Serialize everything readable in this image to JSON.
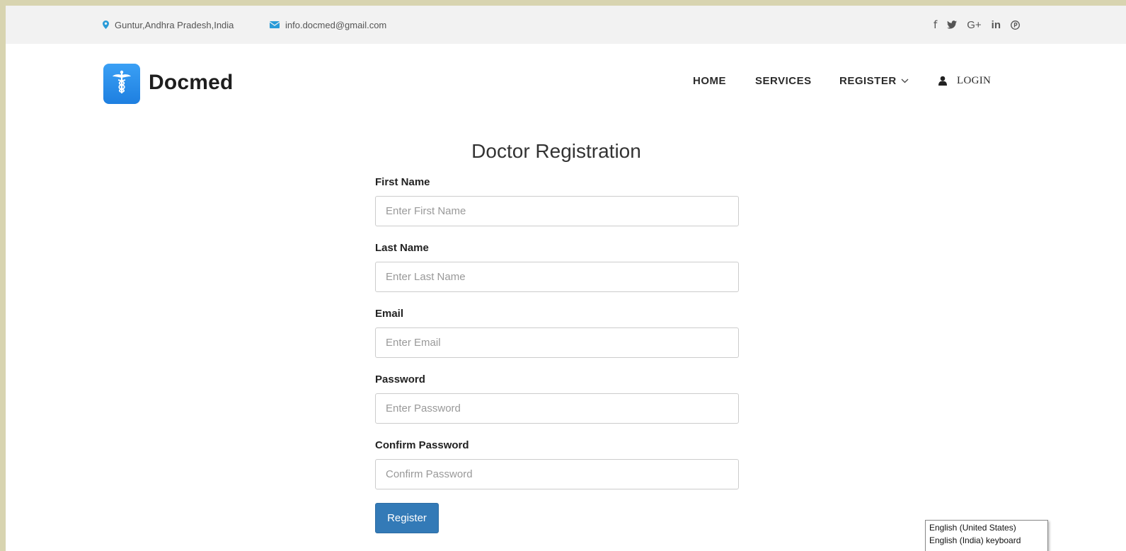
{
  "topbar": {
    "location": "Guntur,Andhra Pradesh,India",
    "email": "info.docmed@gmail.com",
    "social": {
      "facebook": "f",
      "twitter": "🐦",
      "googleplus": "G+",
      "linkedin": "in",
      "pinterest": "℗"
    }
  },
  "header": {
    "brand": "Docmed",
    "nav": {
      "home": "HOME",
      "services": "SERVICES",
      "register": "REGISTER",
      "login": "LOGIN"
    }
  },
  "form": {
    "title": "Doctor Registration",
    "fields": [
      {
        "label": "First Name",
        "placeholder": "Enter First Name",
        "value": ""
      },
      {
        "label": "Last Name",
        "placeholder": "Enter Last Name",
        "value": ""
      },
      {
        "label": "Email",
        "placeholder": "Enter Email",
        "value": ""
      },
      {
        "label": "Password",
        "placeholder": "Enter Password",
        "value": ""
      },
      {
        "label": "Confirm Password",
        "placeholder": "Confirm Password",
        "value": ""
      }
    ],
    "submit_label": "Register"
  },
  "language_popup": {
    "items": [
      "English (United States)",
      "English (India) keyboard"
    ]
  },
  "colors": {
    "accent": "#337ab7",
    "logo": "#2a8ff0",
    "topbar_bg": "#f2f2f2",
    "frame_bg": "#d8d4b0"
  },
  "icons": {
    "location": "map-marker-icon",
    "email": "envelope-icon",
    "logo": "caduceus-icon",
    "user": "user-icon",
    "dropdown": "chevron-down-icon"
  }
}
